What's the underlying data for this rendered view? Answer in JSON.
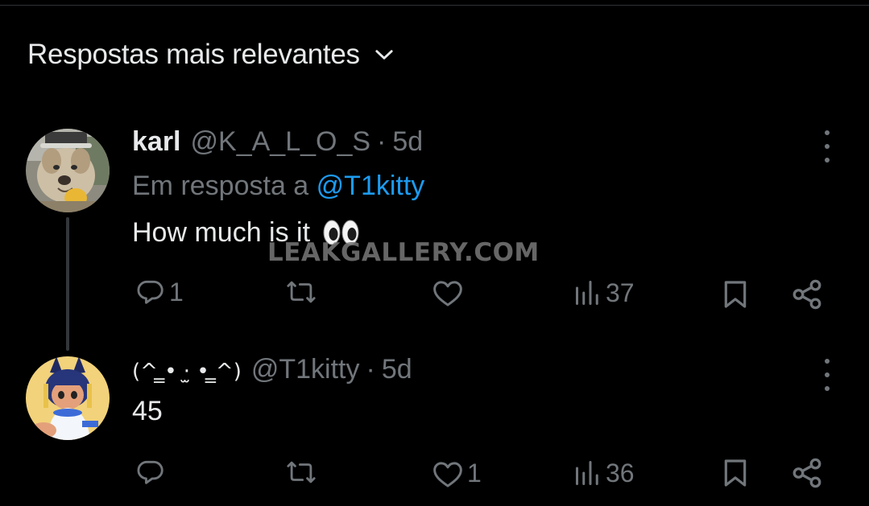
{
  "sort": {
    "label": "Respostas mais relevantes",
    "icon": "chevron-down-icon"
  },
  "watermark": "LEAKGALLERY.COM",
  "colors": {
    "background": "#000000",
    "primary_text": "#e7e9ea",
    "secondary_text": "#71767b",
    "link": "#1d9bf0"
  },
  "posts": [
    {
      "display_name": "karl",
      "handle": "@K_A_L_O_S",
      "separator": "·",
      "time": "5d",
      "reply_prefix": "Em resposta a",
      "reply_mention": "@T1kitty",
      "text": "How much is it",
      "emoji_icon": "eyes-emoji",
      "actions": {
        "replies": "1",
        "reposts": "",
        "likes": "",
        "views": "37"
      }
    },
    {
      "display_name": "(^ ̳• ·̫ • ̳^)",
      "handle": "@T1kitty",
      "separator": "·",
      "time": "5d",
      "text": "45",
      "actions": {
        "replies": "",
        "reposts": "",
        "likes": "1",
        "views": "36"
      }
    }
  ]
}
